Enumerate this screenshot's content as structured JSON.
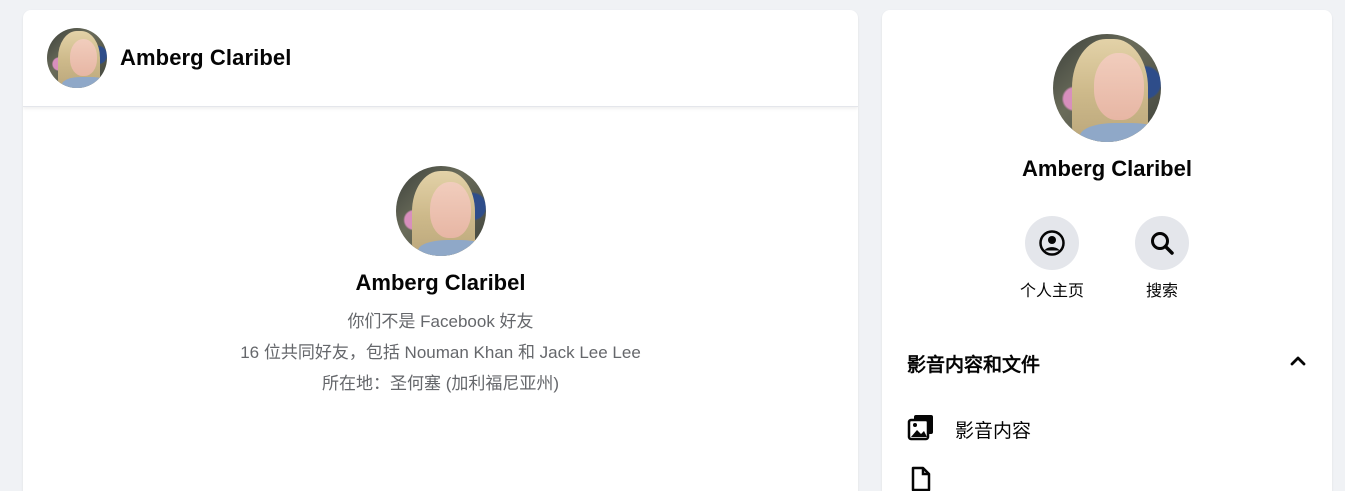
{
  "chat": {
    "header_name": "Amberg Claribel",
    "intro": {
      "name": "Amberg Claribel",
      "not_friends": "你们不是 Facebook 好友",
      "mutual_friends": "16 位共同好友，包括 Nouman Khan 和 Jack Lee Lee",
      "location": "所在地：圣何塞 (加利福尼亚州)"
    }
  },
  "info": {
    "name": "Amberg Claribel",
    "actions": [
      {
        "label": "个人主页",
        "icon": "profile-icon"
      },
      {
        "label": "搜索",
        "icon": "search-icon"
      }
    ],
    "section": {
      "title": "影音内容和文件",
      "toggle_icon": "chevron-up-icon",
      "items": [
        {
          "label": "影音内容",
          "icon": "photos-icon"
        },
        {
          "label": "",
          "icon": "files-icon"
        }
      ]
    }
  },
  "colors": {
    "background": "#f0f2f5",
    "panel": "#ffffff",
    "secondary_text": "#65676b",
    "icon_circle": "#e4e6eb"
  }
}
